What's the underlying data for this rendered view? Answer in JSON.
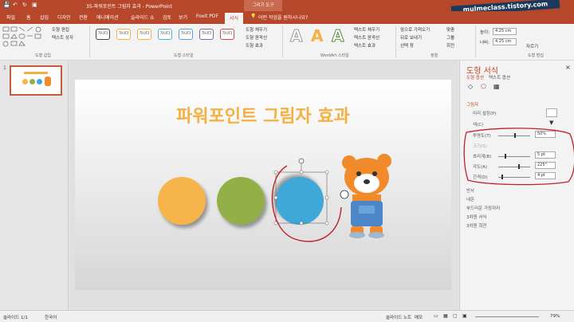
{
  "window": {
    "title": "35-파워포인트 그림자 효과 - PowerPoint",
    "tools_label": "그리기 도구"
  },
  "watermark": "mulmeclass.tistory.com",
  "tabs": [
    "파일",
    "홈",
    "삽입",
    "디자인",
    "전환",
    "애니메이션",
    "슬라이드 쇼",
    "검토",
    "보기",
    "Foxit PDF",
    "서식"
  ],
  "active_tab": "서식",
  "tell_me": "어떤 작업을 원하시나요?",
  "ribbon": {
    "shape_edit": "도형 편집",
    "text_box": "텍스트 상자",
    "insert_group": "도형 삽입",
    "style_label": "가나다",
    "styles_group": "도형 스타일",
    "fill": "도형 채우기",
    "outline": "도형 윤곽선",
    "effect": "도형 효과",
    "wordart_letter": "A",
    "text_fill": "텍스트 채우기",
    "text_outline": "텍스트 윤곽선",
    "text_effect": "텍스트 효과",
    "wordart_group": "WordArt 스타일",
    "bring_forward": "앞으로 가져오기",
    "send_backward": "뒤로 보내기",
    "selection_pane": "선택 창",
    "align": "맞춤",
    "group": "그룹",
    "rotate": "회전",
    "arrange_group": "정렬",
    "height_label": "높이:",
    "height_val": "4.25 cm",
    "width_label": "너비:",
    "width_val": "4.25 cm",
    "crop": "자르기",
    "size_group": "도형 편집"
  },
  "slide_panel": {
    "number": "1"
  },
  "slide": {
    "title": "파워포인트 그림자 효과",
    "circles": [
      {
        "name": "orange-circle",
        "color": "#f6b44a"
      },
      {
        "name": "green-circle",
        "color": "#93b048"
      },
      {
        "name": "blue-circle",
        "color": "#3ea8d8"
      }
    ]
  },
  "pane": {
    "title": "도형 서식",
    "tab1": "도형 옵션",
    "tab2": "텍스트 옵션",
    "section_shadow": "그림자",
    "preset": "미리 설정(P)",
    "color": "색(C)",
    "transparency": "투명도(T)",
    "transparency_val": "50%",
    "size": "크기(S)",
    "blur": "흐리게(B)",
    "blur_val": "5 pt",
    "angle": "각도(A)",
    "angle_val": "225°",
    "distance": "간격(D)",
    "distance_val": "4 pt",
    "reflection": "반사",
    "glow": "네온",
    "soft_edges": "부드러운 가장자리",
    "format_3d": "3차원 서식",
    "rotation_3d": "3차원 회전",
    "transparency_level": 0.5,
    "blur_level": 0.2,
    "angle_level": 0.62,
    "distance_level": 0.1
  },
  "status": {
    "slide": "슬라이드 1/1",
    "lang": "한국어",
    "notes": "슬라이드 노트",
    "memo": "메모",
    "zoom": "79%"
  }
}
